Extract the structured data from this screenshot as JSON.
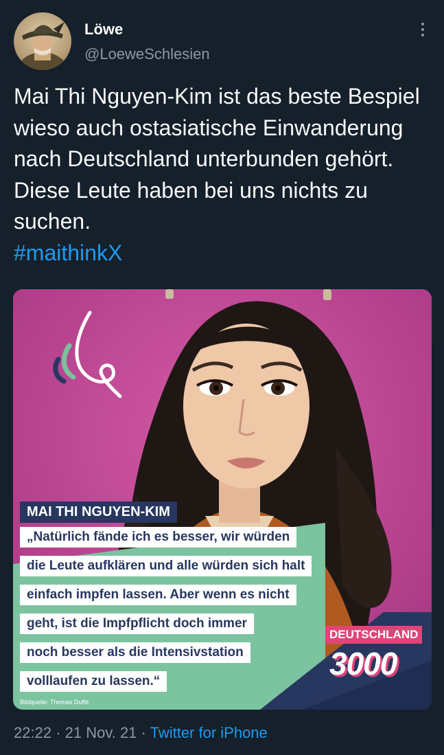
{
  "author": {
    "display_name": "Löwe",
    "handle": "@LoeweSchlesien"
  },
  "tweet": {
    "text": "Mai Thi Nguyen-Kim ist das beste Bespiel wieso auch ostasiatische Einwanderung nach Deutschland unterbunden gehört. Diese Leute haben bei uns nichts zu suchen.",
    "hashtag": "#maithinkX"
  },
  "media": {
    "name_banner": "MAI THI NGUYEN-KIM",
    "quote_lines": [
      "„Natürlich fände ich es besser, wir würden",
      "die Leute aufklären und alle würden sich halt",
      "einfach impfen lassen. Aber wenn es nicht",
      "geht, ist die Impfpflicht doch immer",
      "noch besser als die Intensivstation",
      "volllaufen zu lassen.“"
    ],
    "badge_top": "DEUTSCHLAND",
    "badge_number": "3000",
    "credit": "Bildquelle: Thomas Duffé"
  },
  "meta": {
    "time": "22:22",
    "separator": "·",
    "date": "21 Nov. 21",
    "source": "Twitter for iPhone"
  },
  "colors": {
    "background": "#15202b",
    "link": "#1d9bf0",
    "secondary_text": "#8b98a5",
    "media_magenta": "#c44a97",
    "media_green": "#78c29c",
    "banner_navy": "#27375f",
    "badge_pink": "#e0457a"
  },
  "icons": [
    "more-options-icon"
  ]
}
